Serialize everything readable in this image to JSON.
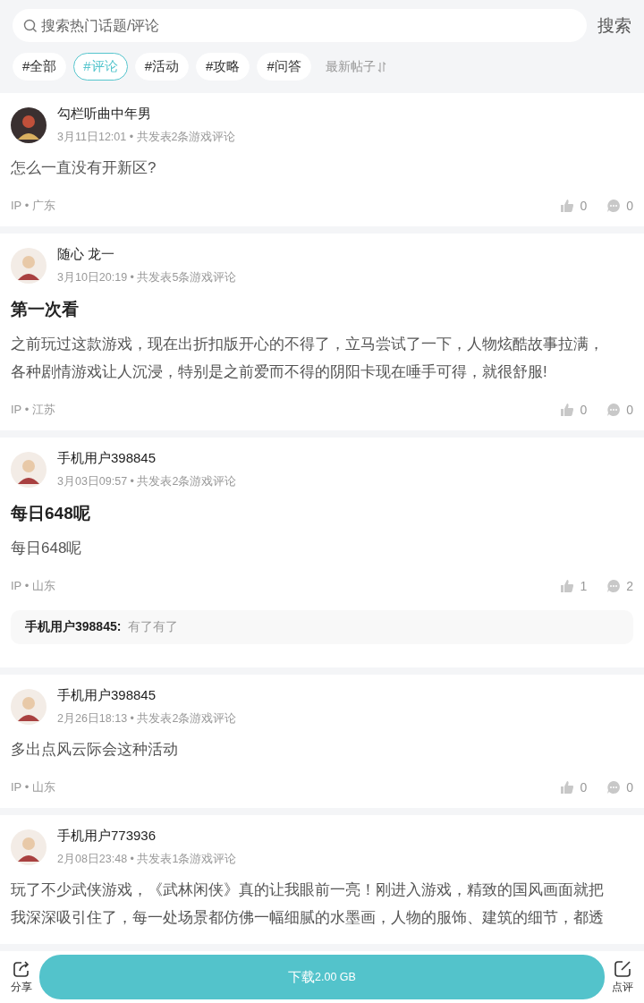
{
  "search": {
    "placeholder": "搜索热门话题/评论",
    "button": "搜索"
  },
  "tags": [
    {
      "label": "#全部",
      "selected": false
    },
    {
      "label": "#评论",
      "selected": true
    },
    {
      "label": "#活动",
      "selected": false
    },
    {
      "label": "#攻略",
      "selected": false
    },
    {
      "label": "#问答",
      "selected": false
    }
  ],
  "sort": {
    "label": "最新帖子"
  },
  "posts": [
    {
      "user": "勾栏听曲中年男",
      "meta": "3月11日12:01 • 共发表2条游戏评论",
      "body": "怎么一直没有开新区?",
      "ip": "IP • 广东",
      "likes": "0",
      "comments": "0"
    },
    {
      "user": "随心 龙一",
      "meta": "3月10日20:19 • 共发表5条游戏评论",
      "title": "第一次看",
      "body": "之前玩过这款游戏，现在出折扣版开心的不得了，立马尝试了一下，人物炫酷故事拉满，各种剧情游戏让人沉浸，特别是之前爱而不得的阴阳卡现在唾手可得，就很舒服!",
      "ip": "IP • 江苏",
      "likes": "0",
      "comments": "0"
    },
    {
      "user": "手机用户398845",
      "meta": "3月03日09:57 • 共发表2条游戏评论",
      "title": "每日648呢",
      "body": "每日648呢",
      "ip": "IP • 山东",
      "likes": "1",
      "comments": "2",
      "reply": {
        "user": "手机用户398845:",
        "text": "有了有了"
      }
    },
    {
      "user": "手机用户398845",
      "meta": "2月26日18:13 • 共发表2条游戏评论",
      "body": "多出点风云际会这种活动",
      "ip": "IP • 山东",
      "likes": "0",
      "comments": "0"
    },
    {
      "user": "手机用户773936",
      "meta": "2月08日23:48 • 共发表1条游戏评论",
      "body": "玩了不少武侠游戏，《武林闲侠》真的让我眼前一亮！刚进入游戏，精致的国风画面就把我深深吸引住了，每一处场景都仿佛一幅细腻的水墨画，人物的服饰、建筑的细节，都透"
    }
  ],
  "bottom_bar": {
    "share": "分享",
    "download": "下载",
    "size": "2.00 GB",
    "review": "点评"
  }
}
